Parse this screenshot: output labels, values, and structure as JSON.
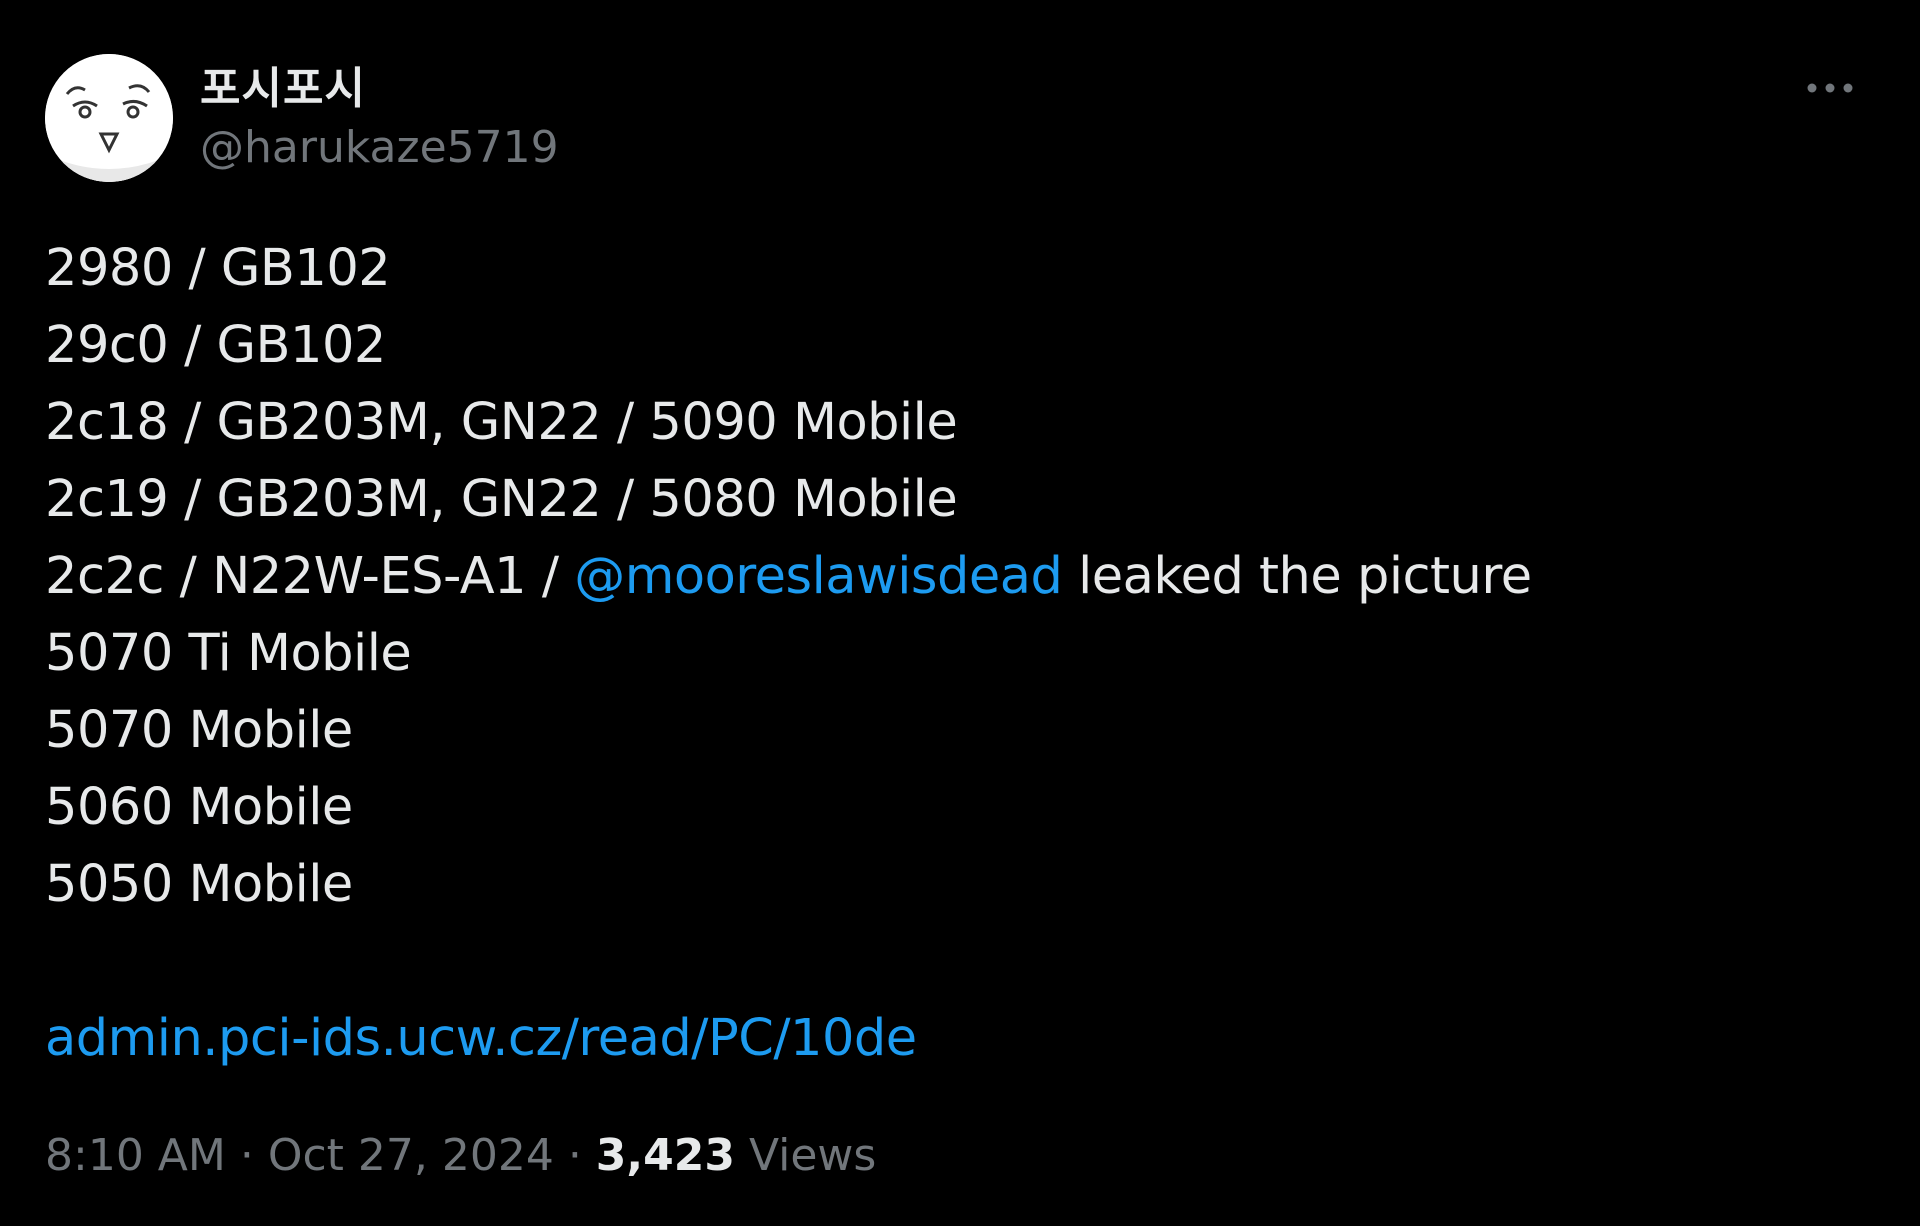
{
  "author": {
    "display_name": "포시포시",
    "handle": "@harukaze5719"
  },
  "tweet": {
    "lines": [
      "2980 / GB102",
      "29c0 / GB102",
      "2c18 / GB203M, GN22 / 5090 Mobile",
      "2c19 / GB203M, GN22 / 5080 Mobile"
    ],
    "mention_line_prefix": "2c2c / N22W-ES-A1 / ",
    "mention": "@mooreslawisdead",
    "mention_line_suffix": " leaked the picture",
    "lines_after": [
      "5070 Ti Mobile",
      "5070 Mobile",
      "5060 Mobile",
      "5050 Mobile"
    ],
    "link_text": "admin.pci-ids.ucw.cz/read/PC/10de"
  },
  "meta": {
    "time": "8:10 AM",
    "separator": " · ",
    "date": "Oct 27, 2024",
    "views_count": "3,423",
    "views_label": "Views"
  },
  "icons": {
    "more": "more-horizontal-icon",
    "avatar": "cartoon-face-avatar"
  },
  "colors": {
    "background": "#000000",
    "text": "#e7e9ea",
    "secondary": "#71767b",
    "link": "#1d9bf0"
  }
}
